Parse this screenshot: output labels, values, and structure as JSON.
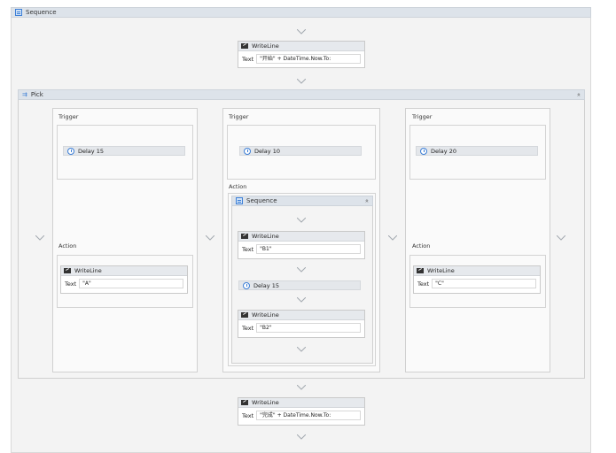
{
  "sequence": {
    "title": "Sequence"
  },
  "top_writeline": {
    "title": "WriteLine",
    "text_label": "Text",
    "text_value": "\"开始\" + DateTime.Now.To:"
  },
  "pick": {
    "title": "Pick",
    "collapse_glyph": "»"
  },
  "branches": [
    {
      "trigger_label": "Trigger",
      "delay_label": "Delay 15",
      "action_label": "Action",
      "writeline": {
        "title": "WriteLine",
        "text_label": "Text",
        "text_value": "\"A\""
      }
    },
    {
      "trigger_label": "Trigger",
      "delay_label": "Delay 10",
      "action_label": "Action",
      "sequence": {
        "title": "Sequence",
        "collapse_glyph": "»",
        "writeline1": {
          "title": "WriteLine",
          "text_label": "Text",
          "text_value": "\"B1\""
        },
        "delay_label": "Delay 15",
        "writeline2": {
          "title": "WriteLine",
          "text_label": "Text",
          "text_value": "\"B2\""
        }
      }
    },
    {
      "trigger_label": "Trigger",
      "delay_label": "Delay 20",
      "action_label": "Action",
      "writeline": {
        "title": "WriteLine",
        "text_label": "Text",
        "text_value": "\"C\""
      }
    }
  ],
  "bottom_writeline": {
    "title": "WriteLine",
    "text_label": "Text",
    "text_value": "\"完成\" + DateTime.Now.To:"
  },
  "icons": {
    "sequence": "sequence-icon",
    "pick": "pick-icon",
    "writeline": "writeline-icon",
    "delay": "clock-icon",
    "drop": "drop-target-chevron-icon",
    "collapse": "collapse-chevron-icon"
  },
  "colors": {
    "accent": "#3d7fd6",
    "header": "#dde3ea",
    "canvas": "#f3f3f3"
  }
}
